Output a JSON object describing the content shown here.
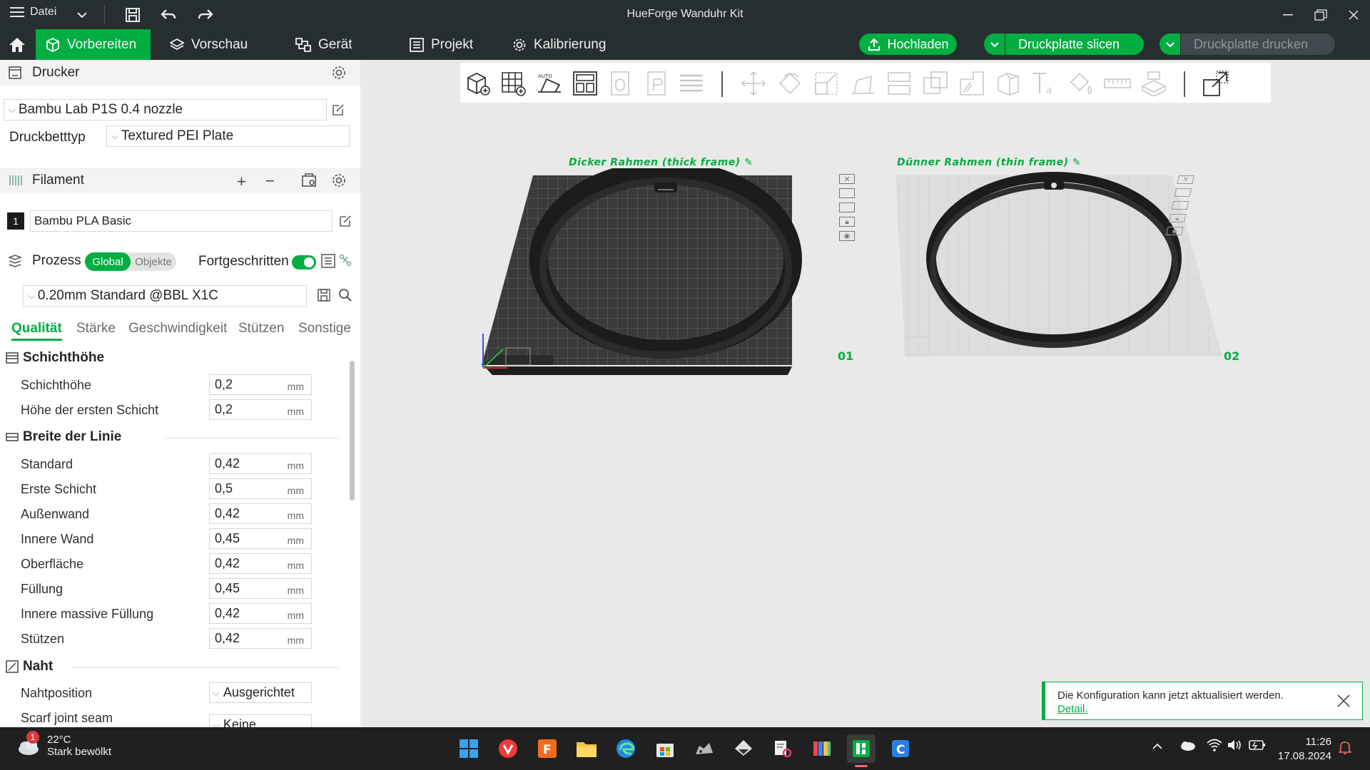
{
  "titlebar": {
    "menu_label": "Datei",
    "title": "HueForge Wanduhr Kit"
  },
  "tabs": [
    {
      "label": "Vorbereiten",
      "icon": "cube-icon",
      "active": true
    },
    {
      "label": "Vorschau",
      "icon": "layers-icon",
      "active": false
    },
    {
      "label": "Gerät",
      "icon": "device-icon",
      "active": false
    },
    {
      "label": "Projekt",
      "icon": "project-icon",
      "active": false
    },
    {
      "label": "Kalibrierung",
      "icon": "calibration-icon",
      "active": false
    }
  ],
  "actions": {
    "upload": "Hochladen",
    "slice": "Druckplatte slicen",
    "print": "Druckplatte drucken"
  },
  "printer": {
    "heading": "Drucker",
    "selected": "Bambu Lab P1S 0.4 nozzle",
    "bed_label": "Druckbetttyp",
    "bed_value": "Textured PEI Plate"
  },
  "filament": {
    "heading": "Filament",
    "slot": "1",
    "name": "Bambu PLA Basic"
  },
  "process": {
    "heading": "Prozess",
    "seg_on": "Global",
    "seg_off": "Objekte",
    "advanced_label": "Fortgeschritten",
    "advanced_on": true,
    "preset": "0.20mm Standard @BBL X1C"
  },
  "subtabs": [
    "Qualität",
    "Stärke",
    "Geschwindigkeit",
    "Stützen",
    "Sonstige"
  ],
  "unit": "mm",
  "groups": {
    "layer": {
      "title": "Schichthöhe",
      "rows": [
        {
          "label": "Schichthöhe",
          "value": "0,2"
        },
        {
          "label": "Höhe der ersten Schicht",
          "value": "0,2"
        }
      ]
    },
    "width": {
      "title": "Breite der Linie",
      "rows": [
        {
          "label": "Standard",
          "value": "0,42"
        },
        {
          "label": "Erste Schicht",
          "value": "0,5"
        },
        {
          "label": "Außenwand",
          "value": "0,42"
        },
        {
          "label": "Innere Wand",
          "value": "0,45"
        },
        {
          "label": "Oberfläche",
          "value": "0,42"
        },
        {
          "label": "Füllung",
          "value": "0,45"
        },
        {
          "label": "Innere massive Füllung",
          "value": "0,42"
        },
        {
          "label": "Stützen",
          "value": "0,42"
        }
      ]
    },
    "seam": {
      "title": "Naht",
      "rows": [
        {
          "label": "Nahtposition",
          "value": "Ausgerichtet"
        },
        {
          "label": "Scarf joint seam",
          "value": "Keine"
        }
      ]
    }
  },
  "plates": [
    {
      "label": "Dicker Rahmen  (thick frame)",
      "number": "01"
    },
    {
      "label": "Dünner Rahmen (thin frame)",
      "number": "02"
    }
  ],
  "notice": {
    "text": "Die Konfiguration kann jetzt aktualisiert werden.",
    "link": "Detail."
  },
  "taskbar": {
    "weather_badge": "1",
    "temperature": "22°C",
    "weather": "Stark bewölkt",
    "time": "11:26",
    "date": "17.08.2024"
  },
  "colors": {
    "accent": "#00ae42",
    "titlebar": "#262e30",
    "taskbar": "#202020"
  }
}
